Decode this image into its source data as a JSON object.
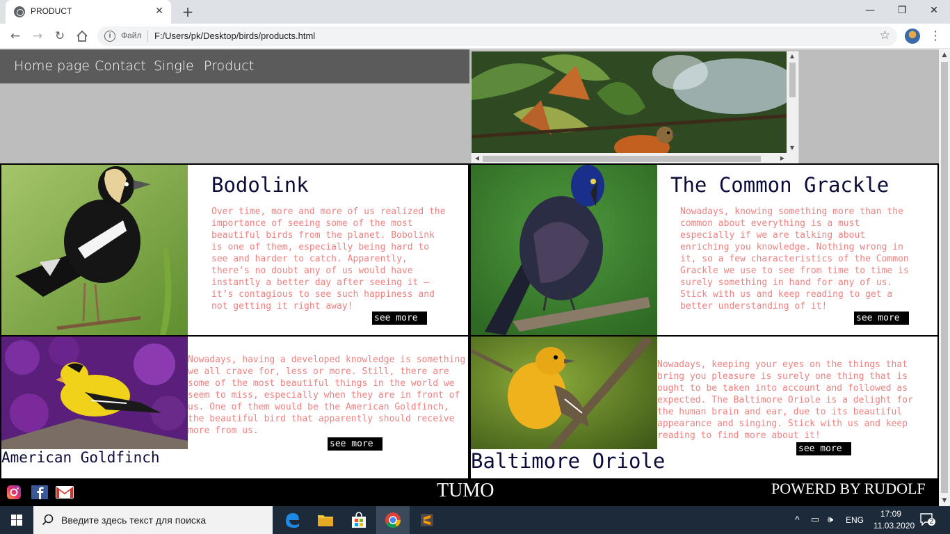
{
  "browser": {
    "tab_title": "PRODUCT",
    "scheme_label": "Файл",
    "url": "F:/Users/pk/Desktop/birds/products.html"
  },
  "nav": {
    "items": [
      {
        "label": "Home page"
      },
      {
        "label": "Contact"
      },
      {
        "label": "Single"
      },
      {
        "label": "Product"
      }
    ]
  },
  "cards": [
    {
      "title": "Bodolink",
      "text": "Over time, more and more of us realized the importance of seeing some of the most beautiful birds from the planet. Bobolink is one of them, especially being hard to see and harder to catch. Apparently, there’s no doubt any of us would have instantly a better day after seeing it – it’s contagious to see such happiness and not getting it right away!",
      "button": "see more"
    },
    {
      "title": "The Common Grackle",
      "text": "Nowadays, knowing something more than the common about everything is a must especially if we are talking about enriching you knowledge. Nothing wrong in it, so a few characteristics of the Common Grackle we use to see from time to time is surely something in hand for any of us. Stick with us and keep reading to get a better understanding of it!",
      "button": "see more"
    },
    {
      "title": "American Goldfinch",
      "text": "Nowadays, having a developed knowledge is something we all crave for, less or more. Still, there are some of the most beautiful things in the world we seem to miss, especially when they are in front of us. One of them would be the American Goldfinch, the beautiful bird that apparently should receive more from us.",
      "button": "see more"
    },
    {
      "title": "Baltimore Oriole",
      "text": "Nowadays, keeping your eyes on the things that bring you pleasure is surely one thing that is ought to be taken into account and followed as expected. The Baltimore Oriole is a delight for the human brain and ear, due to its beautiful appearance and singing. Stick with us and keep reading to find more about it!",
      "button": "see more"
    }
  ],
  "footer": {
    "brand": "TUMO",
    "powered": "POWERD BY RUDOLF",
    "social_icons": [
      "instagram-icon",
      "facebook-icon",
      "gmail-icon"
    ]
  },
  "taskbar": {
    "search_placeholder": "Введите здесь текст для поиска",
    "language": "ENG",
    "time": "17:09",
    "date": "11.03.2020",
    "notification_count": "2"
  },
  "colors": {
    "nav_bg": "#5b5b5b",
    "page_bg": "#bdbdbd",
    "title_color": "#0b0b3a",
    "body_text": "#f08080",
    "button_bg": "#000000"
  }
}
